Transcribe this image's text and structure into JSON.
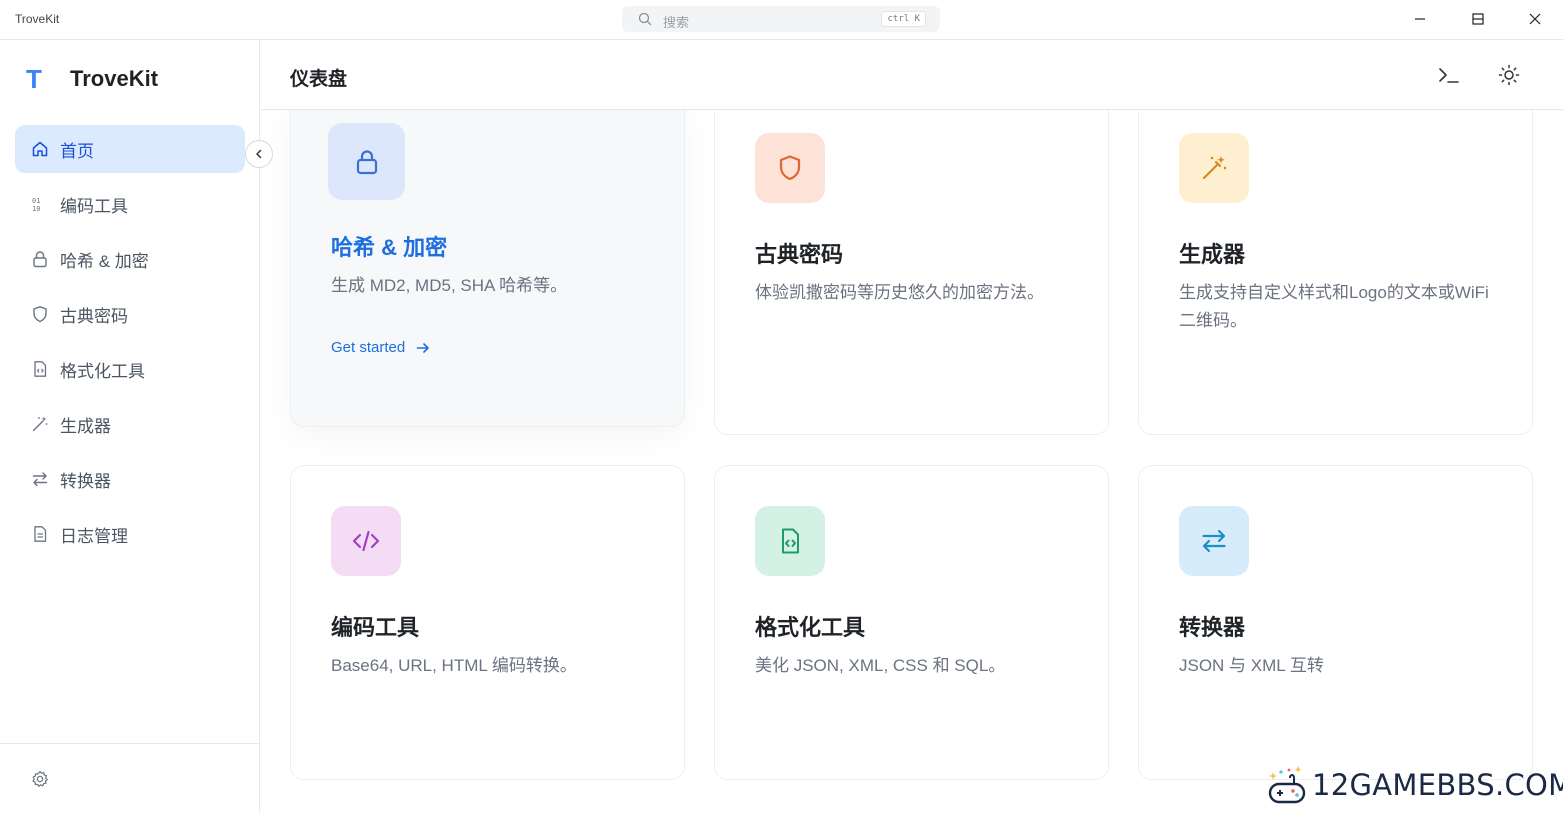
{
  "window": {
    "title": "TroveKit"
  },
  "search": {
    "placeholder": "搜索",
    "shortcut": "ctrl K"
  },
  "sidebar": {
    "brand_letter": "T",
    "brand_name": "TroveKit",
    "items": [
      {
        "label": "首页",
        "icon": "home-icon",
        "active": true
      },
      {
        "label": "编码工具",
        "icon": "binary-icon"
      },
      {
        "label": "哈希 & 加密",
        "icon": "lock-icon"
      },
      {
        "label": "古典密码",
        "icon": "shield-icon"
      },
      {
        "label": "格式化工具",
        "icon": "file-code-icon"
      },
      {
        "label": "生成器",
        "icon": "magic-wand-icon"
      },
      {
        "label": "转换器",
        "icon": "arrows-exchange-icon"
      },
      {
        "label": "日志管理",
        "icon": "document-icon"
      }
    ]
  },
  "header": {
    "title": "仪表盘"
  },
  "cards": [
    {
      "title": "哈希 & 加密",
      "desc": "生成 MD2, MD5, SHA 哈希等。",
      "cta": "Get started",
      "icon": "lock-icon",
      "icon_bg": "#dde7fb",
      "icon_color": "#3a6fd8"
    },
    {
      "title": "古典密码",
      "desc": "体验凯撒密码等历史悠久的加密方法。",
      "icon": "shield-icon",
      "icon_bg": "#fde2d8",
      "icon_color": "#e0662f"
    },
    {
      "title": "生成器",
      "desc": "生成支持自定义样式和Logo的文本或WiFi二维码。",
      "icon": "magic-wand-icon",
      "icon_bg": "#fdefcf",
      "icon_color": "#d98a1c"
    },
    {
      "title": "编码工具",
      "desc": "Base64, URL, HTML 编码转换。",
      "icon": "code-icon",
      "icon_bg": "#f5dcf5",
      "icon_color": "#a23fc4"
    },
    {
      "title": "格式化工具",
      "desc": "美化 JSON, XML, CSS 和 SQL。",
      "icon": "file-code-icon",
      "icon_bg": "#d4f1e5",
      "icon_color": "#1e9a6e"
    },
    {
      "title": "转换器",
      "desc": "JSON 与 XML 互转",
      "icon": "arrows-exchange-icon",
      "icon_bg": "#d6ecfa",
      "icon_color": "#1d8fc4"
    }
  ],
  "watermark": {
    "text": "12GAMEBBS.COM"
  },
  "colors": {
    "accent": "#1d6fe0",
    "active_nav_bg": "#dbeafe"
  }
}
